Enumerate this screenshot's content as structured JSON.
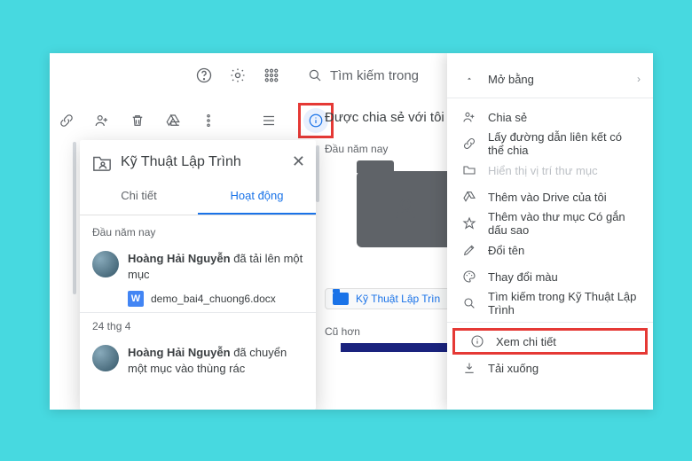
{
  "topbar": {
    "search_placeholder": "Tìm kiếm trong"
  },
  "main_title": "Được chia sẻ với tôi",
  "section_early": "Đầu năm nay",
  "section_older": "Cũ hơn",
  "folder_chip_label": "Kỹ Thuật Lập Trìn",
  "panel": {
    "title": "Kỹ Thuật Lập Trình",
    "tab_detail": "Chi tiết",
    "tab_activity": "Hoạt động",
    "section1": "Đầu năm nay",
    "activity1_name": "Hoàng Hải Nguyễn",
    "activity1_action": " đã tải lên một mục",
    "file1_name": "demo_bai4_chuong6.docx",
    "date2": "24 thg 4",
    "activity2_name": "Hoàng Hải Nguyễn",
    "activity2_action": " đã chuyển một mục vào thùng rác"
  },
  "ctx": {
    "open_with": "Mở bằng",
    "share": "Chia sẻ",
    "get_link": "Lấy đường dẫn liên kết có thể chia",
    "show_location": "Hiển thị vị trí thư mục",
    "add_drive": "Thêm vào Drive của tôi",
    "add_starred": "Thêm vào thư mục Có gắn dấu sao",
    "rename": "Đổi tên",
    "change_color": "Thay đổi màu",
    "search_in": "Tìm kiếm trong Kỹ Thuật Lập Trình",
    "view_details": "Xem chi tiết",
    "download": "Tải xuống"
  }
}
